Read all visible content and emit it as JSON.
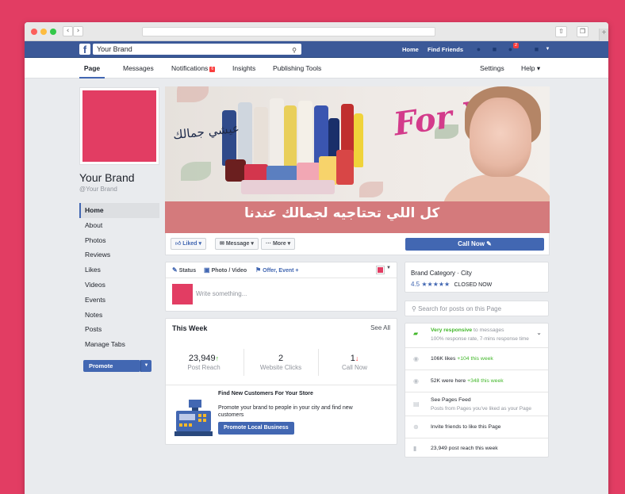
{
  "topbar": {
    "search_value": "Your Brand",
    "home": "Home",
    "find_friends": "Find Friends",
    "notif_badge": "2"
  },
  "pagenav": {
    "page": "Page",
    "messages": "Messages",
    "notifications": "Notifications",
    "notif_badge": "6",
    "insights": "Insights",
    "publishing_tools": "Publishing Tools",
    "settings": "Settings",
    "help": "Help ▾"
  },
  "profile": {
    "name": "Your Brand",
    "handle": "@Your Brand"
  },
  "sidebar": {
    "items": [
      "Home",
      "About",
      "Photos",
      "Reviews",
      "Likes",
      "Videos",
      "Events",
      "Notes",
      "Posts",
      "Manage Tabs"
    ],
    "promote": "Promote"
  },
  "cover": {
    "arabic_slogan": "عيشي جمالك",
    "arabic_tagline": "كل اللي تحتاجيه لجمالك عندنا",
    "for_you": "For You"
  },
  "actions": {
    "liked": "Liked ▾",
    "message": "Message ▾",
    "more": "··· More ▾",
    "call_now": "Call Now ✎"
  },
  "composer": {
    "status": "Status",
    "photo_video": "Photo / Video",
    "offer_event": "Offer, Event +",
    "placeholder": "Write something..."
  },
  "this_week": {
    "title": "This Week",
    "see_all": "See All",
    "stats": [
      {
        "num": "23,949",
        "arrow": "↑",
        "label": "Post Reach"
      },
      {
        "num": "2",
        "arrow": "",
        "label": "Website Clicks"
      },
      {
        "num": "1",
        "arrow": "↓",
        "label": "Call Now"
      }
    ],
    "find_title": "Find New Customers For Your Store",
    "find_text": "Promote your brand to people in your city and find new customers",
    "promote_local": "Promote Local Business"
  },
  "about": {
    "category": "Brand Category · City",
    "rating": "4.5",
    "stars": "★★★★★",
    "closed": "CLOSED NOW",
    "search_placeholder": "Search for posts on this Page"
  },
  "info": {
    "responsive": "Very responsive",
    "responsive_suffix": " to messages",
    "response_rate": "100% response rate, 7-mins response time",
    "likes": "106K likes",
    "likes_week": " +104 this week",
    "were_here": "52K were here",
    "were_here_week": " +348 this week",
    "feed": "See Pages Feed",
    "feed_sub": "Posts from Pages you've liked as your Page",
    "invite": "Invite friends to like this Page",
    "reach": "23,949 post reach this week"
  },
  "colors": {
    "background": "#e23d63",
    "fb_blue": "#3b5998",
    "accent": "#4267b2"
  }
}
